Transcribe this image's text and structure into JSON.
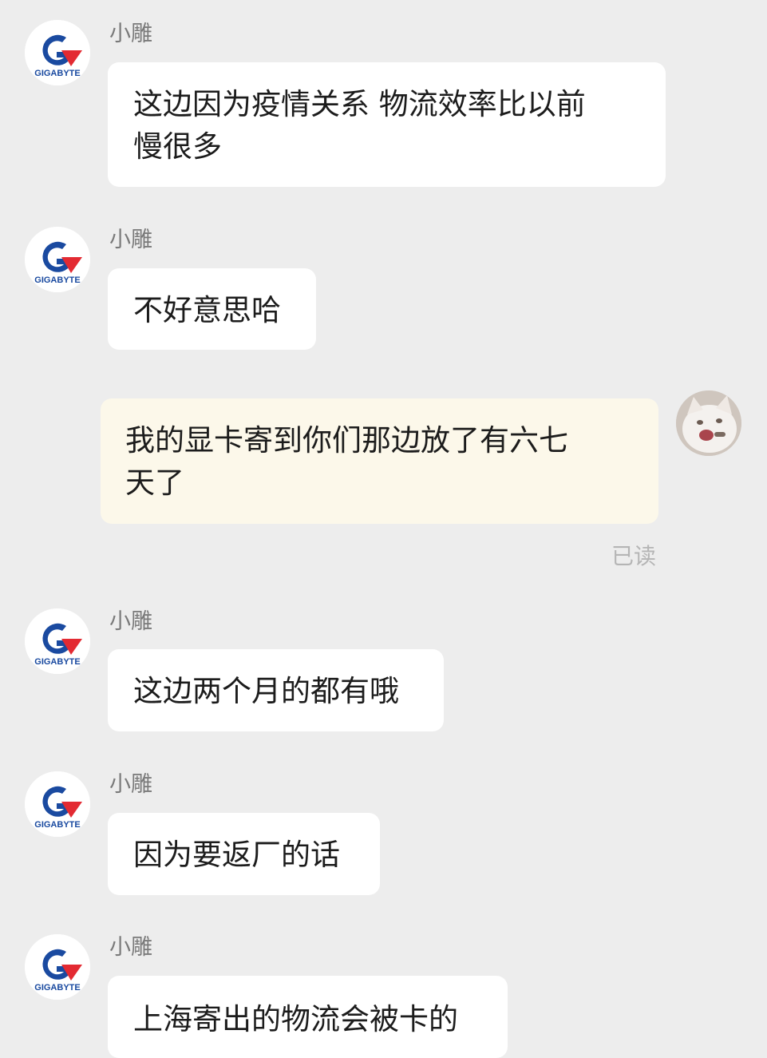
{
  "messages": [
    {
      "sender": "小雕",
      "avatar_icon": "gigabyte-logo-icon",
      "brand_text": "GIGABYTE",
      "text": "这边因为疫情关系 物流效率比以前\n慢很多"
    },
    {
      "sender": "小雕",
      "avatar_icon": "gigabyte-logo-icon",
      "brand_text": "GIGABYTE",
      "text": "不好意思哈"
    },
    {
      "sender": "",
      "avatar_icon": "cat-avatar-icon",
      "text": "我的显卡寄到你们那边放了有六七\n天了",
      "status": "已读"
    },
    {
      "sender": "小雕",
      "avatar_icon": "gigabyte-logo-icon",
      "brand_text": "GIGABYTE",
      "text": "这边两个月的都有哦"
    },
    {
      "sender": "小雕",
      "avatar_icon": "gigabyte-logo-icon",
      "brand_text": "GIGABYTE",
      "text": "因为要返厂的话"
    },
    {
      "sender": "小雕",
      "avatar_icon": "gigabyte-logo-icon",
      "brand_text": "GIGABYTE",
      "text": "上海寄出的物流会被卡的"
    }
  ],
  "colors": {
    "background": "#ededed",
    "incoming_bubble": "#ffffff",
    "outgoing_bubble": "#fcf8ea",
    "brand_blue": "#1a4aa0",
    "brand_red": "#e32a32"
  }
}
